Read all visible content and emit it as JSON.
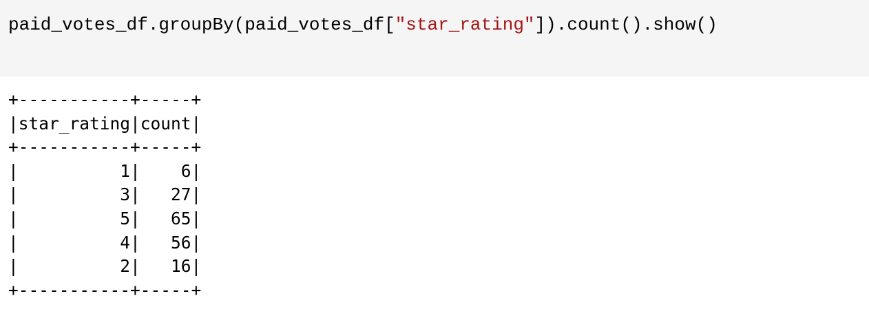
{
  "input_cell": {
    "code_prefix": "paid_votes_df.groupBy(paid_votes_df[",
    "code_string": "\"star_rating\"",
    "code_suffix": "]).count().show()"
  },
  "output": {
    "columns": [
      "star_rating",
      "count"
    ],
    "rows": [
      {
        "star_rating": "1",
        "count": "6"
      },
      {
        "star_rating": "3",
        "count": "27"
      },
      {
        "star_rating": "5",
        "count": "65"
      },
      {
        "star_rating": "4",
        "count": "56"
      },
      {
        "star_rating": "2",
        "count": "16"
      }
    ],
    "lines": [
      "+-----------+-----+",
      "|star_rating|count|",
      "+-----------+-----+",
      "|          1|    6|",
      "|          3|   27|",
      "|          5|   65|",
      "|          4|   56|",
      "|          2|   16|",
      "+-----------+-----+"
    ]
  },
  "colors": {
    "string_literal": "#a31515",
    "cell_background": "#f5f5f5"
  }
}
